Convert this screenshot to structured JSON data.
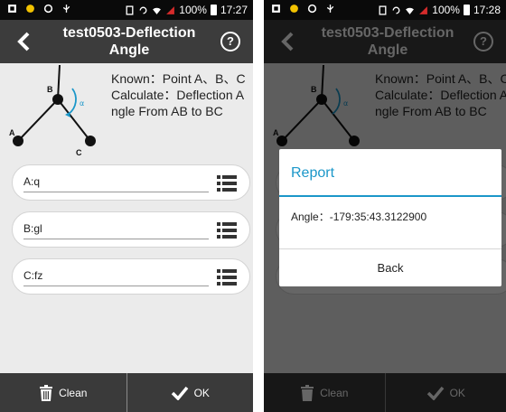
{
  "status_bar": {
    "battery": "100%",
    "time": "17:27",
    "time_right": "17:28"
  },
  "title_bar": {
    "title_line1": "test0503-Deflection",
    "title_line2": "Angle",
    "help": "?"
  },
  "diagram": {
    "point_a": "A",
    "point_b": "B",
    "point_c": "C",
    "angle_symbol": "α"
  },
  "description": {
    "known": "Known：Point A、B、C",
    "calculate": "Calculate：Deflection A ngle From AB to BC"
  },
  "fields": [
    {
      "value": "A:q"
    },
    {
      "value": "B:gl"
    },
    {
      "value": "C:fz"
    }
  ],
  "bottom_bar": {
    "clean_label": "Clean",
    "ok_label": "OK"
  },
  "dialog": {
    "title": "Report",
    "message": "Angle：-179:35:43.3122900",
    "button": "Back"
  },
  "colors": {
    "accent": "#1b97c9",
    "titlebar": "#3c3c3c",
    "bottombar": "#3a3a3a",
    "background": "#ebebeb"
  }
}
